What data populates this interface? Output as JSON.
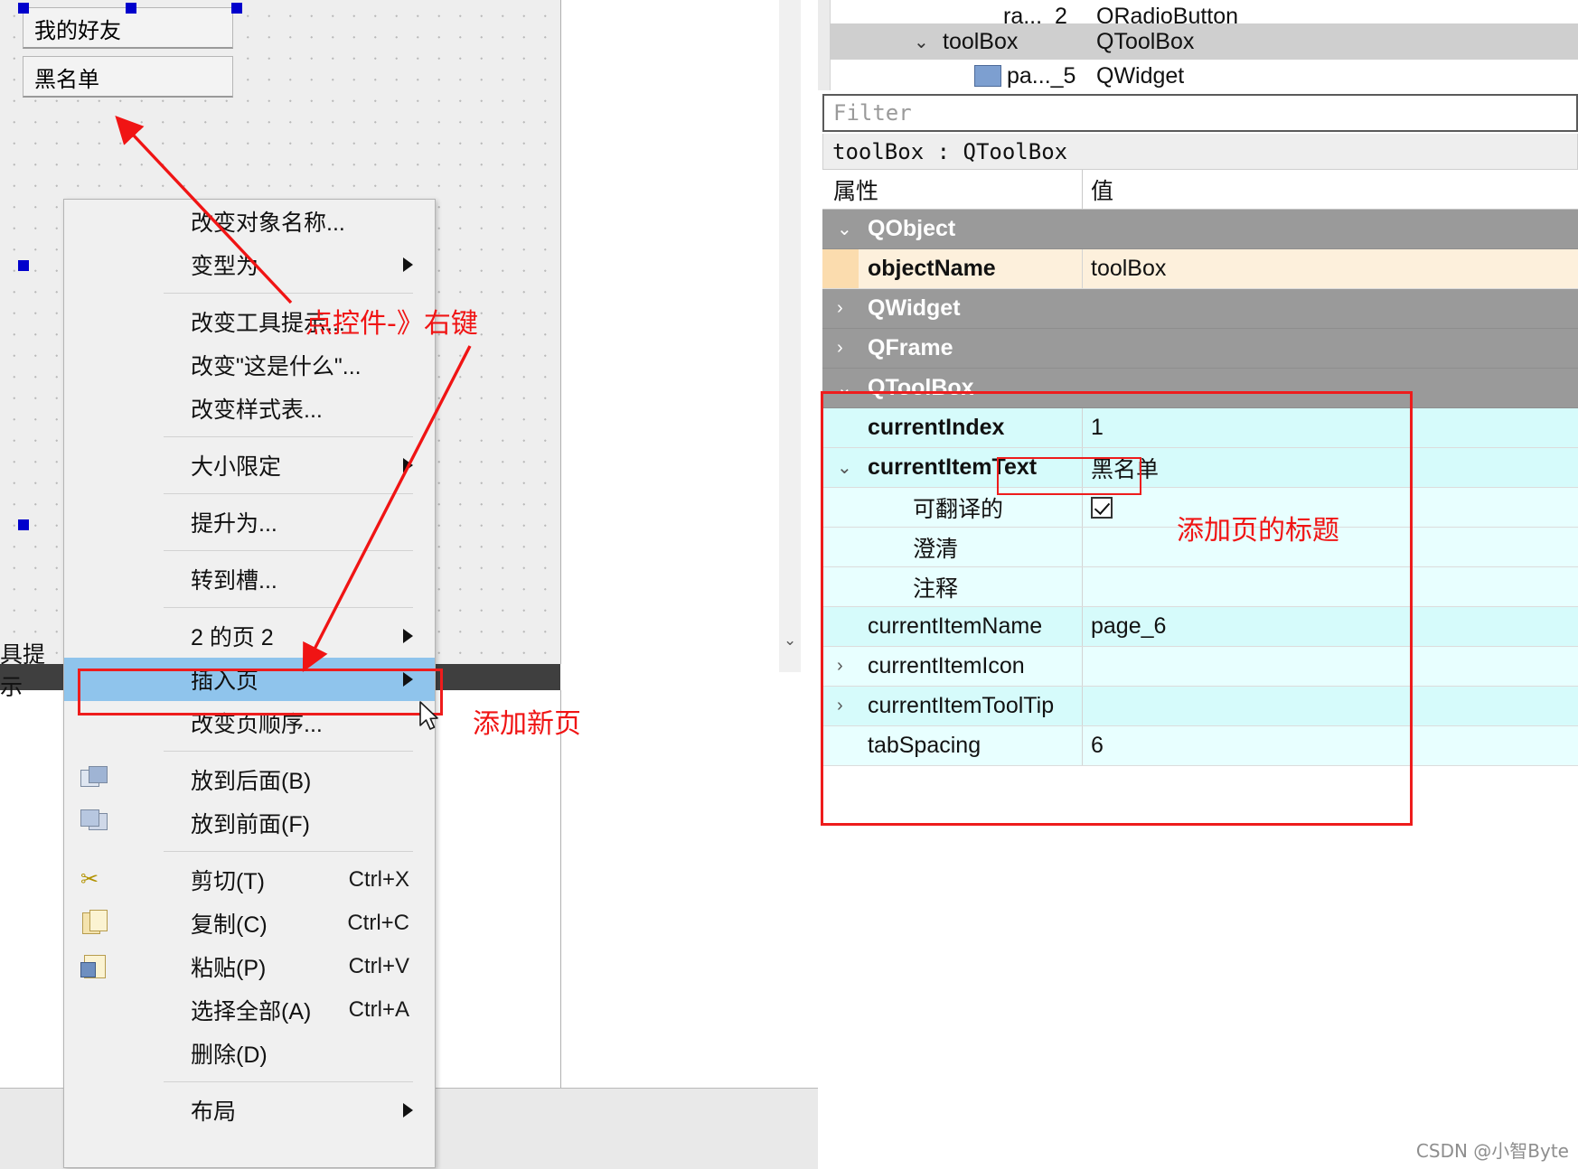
{
  "canvas": {
    "toolbox_tabs": [
      {
        "label": "我的好友",
        "selected": true
      },
      {
        "label": "黑名单",
        "selected": false
      }
    ]
  },
  "context_menu": {
    "items": [
      {
        "label": "改变对象名称...",
        "icon": "",
        "shortcut": "",
        "submenu": false,
        "highlighted": false
      },
      {
        "label": "变型为",
        "icon": "",
        "shortcut": "",
        "submenu": true,
        "highlighted": false
      },
      {
        "separator": true
      },
      {
        "label": "改变工具提示...",
        "icon": "",
        "shortcut": "",
        "submenu": false,
        "highlighted": false
      },
      {
        "label": "改变\"这是什么\"...",
        "icon": "",
        "shortcut": "",
        "submenu": false,
        "highlighted": false
      },
      {
        "label": "改变样式表...",
        "icon": "",
        "shortcut": "",
        "submenu": false,
        "highlighted": false
      },
      {
        "separator": true
      },
      {
        "label": "大小限定",
        "icon": "",
        "shortcut": "",
        "submenu": true,
        "highlighted": false
      },
      {
        "separator": true
      },
      {
        "label": "提升为...",
        "icon": "",
        "shortcut": "",
        "submenu": false,
        "highlighted": false
      },
      {
        "separator": true
      },
      {
        "label": "转到槽...",
        "icon": "",
        "shortcut": "",
        "submenu": false,
        "highlighted": false
      },
      {
        "separator": true
      },
      {
        "label": "2 的页 2",
        "icon": "",
        "shortcut": "",
        "submenu": true,
        "highlighted": false
      },
      {
        "label": "插入页",
        "icon": "",
        "shortcut": "",
        "submenu": true,
        "highlighted": true
      },
      {
        "label": "改变页顺序...",
        "icon": "",
        "shortcut": "",
        "submenu": false,
        "highlighted": false
      },
      {
        "separator": true
      },
      {
        "label": "放到后面(B)",
        "icon": "send-to-back-icon",
        "shortcut": "",
        "submenu": false,
        "highlighted": false
      },
      {
        "label": "放到前面(F)",
        "icon": "bring-to-front-icon",
        "shortcut": "",
        "submenu": false,
        "highlighted": false
      },
      {
        "separator": true
      },
      {
        "label": "剪切(T)",
        "icon": "cut-icon",
        "shortcut": "Ctrl+X",
        "submenu": false,
        "highlighted": false
      },
      {
        "label": "复制(C)",
        "icon": "copy-icon",
        "shortcut": "Ctrl+C",
        "submenu": false,
        "highlighted": false
      },
      {
        "label": "粘贴(P)",
        "icon": "paste-icon",
        "shortcut": "Ctrl+V",
        "submenu": false,
        "highlighted": false
      },
      {
        "label": "选择全部(A)",
        "icon": "",
        "shortcut": "Ctrl+A",
        "submenu": false,
        "highlighted": false
      },
      {
        "label": "删除(D)",
        "icon": "",
        "shortcut": "",
        "submenu": false,
        "highlighted": false
      },
      {
        "separator": true
      },
      {
        "label": "布局",
        "icon": "",
        "shortcut": "",
        "submenu": true,
        "highlighted": false
      }
    ]
  },
  "object_tree": {
    "rows": [
      {
        "name": "ra..._2",
        "class": "QRadioButton",
        "indent": 2,
        "expander": "",
        "selected": false,
        "icon": ""
      },
      {
        "name": "toolBox",
        "class": "QToolBox",
        "indent": 1,
        "expander": "chevron-down-icon",
        "selected": true,
        "icon": ""
      },
      {
        "name": "pa..._5",
        "class": "QWidget",
        "indent": 2,
        "expander": "",
        "selected": false,
        "icon": "page-icon"
      }
    ]
  },
  "filter": {
    "placeholder": "Filter",
    "value": ""
  },
  "selected_object_header": "toolBox : QToolBox",
  "property_editor": {
    "columns": [
      "属性",
      "值"
    ],
    "rows": [
      {
        "kind": "group",
        "name": "QObject",
        "value": "",
        "expander": "chevron-down-icon",
        "indent": 0
      },
      {
        "kind": "objname",
        "name": "objectName",
        "value": "toolBox",
        "expander": "",
        "indent": 0
      },
      {
        "kind": "group",
        "name": "QWidget",
        "value": "",
        "expander": "chevron-right-icon",
        "indent": 0
      },
      {
        "kind": "group",
        "name": "QFrame",
        "value": "",
        "expander": "chevron-right-icon",
        "indent": 0
      },
      {
        "kind": "group",
        "name": "QToolBox",
        "value": "",
        "expander": "chevron-down-icon",
        "indent": 0
      },
      {
        "kind": "cyan",
        "name": "currentIndex",
        "value": "1",
        "expander": "",
        "indent": 1,
        "bold": true
      },
      {
        "kind": "cyan",
        "name": "currentItemText",
        "value": "黑名单",
        "expander": "chevron-down-icon",
        "indent": 1,
        "bold": true,
        "boxed": true
      },
      {
        "kind": "cyan2",
        "name": "可翻译的",
        "value": "",
        "expander": "",
        "indent": 2,
        "checkbox": true
      },
      {
        "kind": "cyan2",
        "name": "澄清",
        "value": "",
        "expander": "",
        "indent": 2
      },
      {
        "kind": "cyan2",
        "name": "注释",
        "value": "",
        "expander": "",
        "indent": 2
      },
      {
        "kind": "cyan",
        "name": "currentItemName",
        "value": "page_6",
        "expander": "",
        "indent": 1
      },
      {
        "kind": "cyan2",
        "name": "currentItemIcon",
        "value": "",
        "expander": "chevron-right-icon",
        "indent": 1
      },
      {
        "kind": "cyan",
        "name": "currentItemToolTip",
        "value": "",
        "expander": "chevron-right-icon",
        "indent": 1
      },
      {
        "kind": "cyan2",
        "name": "tabSpacing",
        "value": "6",
        "expander": "",
        "indent": 1
      }
    ]
  },
  "annotations": [
    {
      "id": "click-widget-right-click",
      "text": "点控件-》右键"
    },
    {
      "id": "add-new-page",
      "text": "添加新页"
    },
    {
      "id": "add-page-title",
      "text": "添加页的标题"
    }
  ],
  "watermark": "CSDN @小智Byte",
  "colors": {
    "annotation_red": "#f01414",
    "menu_highlight": "#8fc4ec",
    "property_group": "#9a9a9a",
    "property_cyan": "#d6fbfb",
    "objectname_row": "#fdf0dc"
  }
}
